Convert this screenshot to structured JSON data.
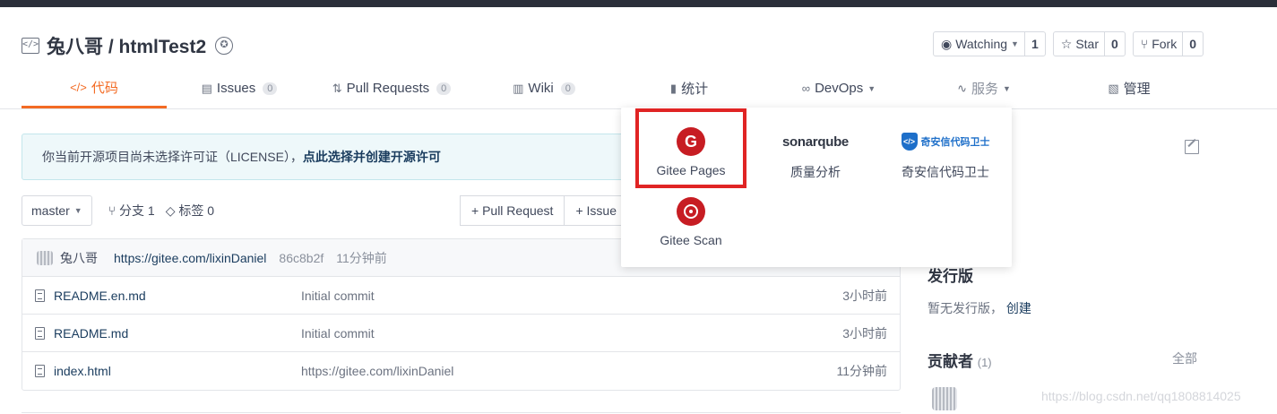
{
  "repo": {
    "title": "兔八哥 / htmlTest2",
    "icon": "code-repo-icon",
    "badge_icon": "award-badge-icon",
    "watch": {
      "label": "Watching",
      "count": "1"
    },
    "star": {
      "label": "Star",
      "count": "0"
    },
    "fork": {
      "label": "Fork",
      "count": "0"
    }
  },
  "nav": {
    "code": "代码",
    "issues": {
      "label": "Issues",
      "count": "0"
    },
    "pulls": {
      "label": "Pull Requests",
      "count": "0"
    },
    "wiki": {
      "label": "Wiki",
      "count": "0"
    },
    "stats": "统计",
    "devops": "DevOps",
    "services": "服务",
    "manage": "管理"
  },
  "license_notice": {
    "text": "你当前开源项目尚未选择许可证（LICENSE），",
    "link": "点此选择并创建开源许可"
  },
  "branch_bar": {
    "branch": "master",
    "branches": "分支 1",
    "tags": "标签 0",
    "pull_request": "+ Pull Request",
    "issue": "+ Issue"
  },
  "latest_commit": {
    "author": "兔八哥",
    "message": "https://gitee.com/lixinDaniel",
    "hash": "86c8b2f",
    "time": "11分钟前"
  },
  "files": [
    {
      "name": "README.en.md",
      "message": "Initial commit",
      "time": "3小时前"
    },
    {
      "name": "README.md",
      "message": "Initial commit",
      "time": "3小时前"
    },
    {
      "name": "index.html",
      "message": "https://gitee.com/lixinDaniel",
      "time": "11分钟前"
    }
  ],
  "services_menu": {
    "gitee_pages": "Gitee Pages",
    "sonarqube_logo": "sonarqube",
    "sonarqube": "质量分析",
    "qianxin_logo": "奇安信代码卫士",
    "qianxin": "奇安信代码卫士",
    "gitee_scan": "Gitee Scan"
  },
  "sidebar": {
    "releases_title": "发行版",
    "releases_empty": "暂无发行版，",
    "releases_create": "创建",
    "contributors_title": "贡献者",
    "contributors_count": "(1)",
    "contributors_all": "全部"
  },
  "watermark": "https://blog.csdn.net/qq1808814025",
  "colors": {
    "accent": "#f36b24",
    "gitee_red": "#c71d23",
    "highlight_red": "#e02424",
    "link_dark": "#1a3c5e"
  }
}
